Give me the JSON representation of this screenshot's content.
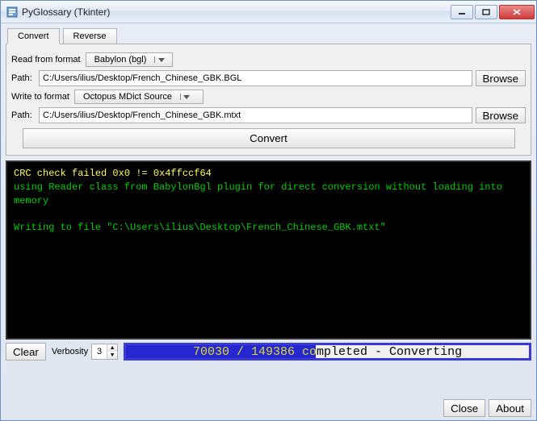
{
  "window": {
    "title": "PyGlossary (Tkinter)"
  },
  "tabs": {
    "convert": "Convert",
    "reverse": "Reverse"
  },
  "form": {
    "read_label": "Read from format",
    "read_format": "Babylon (bgl)",
    "path_label": "Path:",
    "read_path": "C:/Users/ilius/Desktop/French_Chinese_GBK.BGL",
    "browse": "Browse",
    "write_label": "Write to format",
    "write_format": "Octopus MDict Source",
    "write_path": "C:/Users/ilius/Desktop/French_Chinese_GBK.mtxt",
    "convert": "Convert"
  },
  "console": {
    "line1": "CRC check failed 0x0 != 0x4ffccf64",
    "line2": "using Reader class from BabylonBgl plugin for direct conversion without loading into memory",
    "line3": "Writing to file \"C:\\Users\\ilius\\Desktop\\French_Chinese_GBK.mtxt\""
  },
  "bottom": {
    "clear": "Clear",
    "verbosity_label": "Verbosity",
    "verbosity_value": "3",
    "progress_text": "70030 / 149386 completed - Converting"
  },
  "footer": {
    "close": "Close",
    "about": "About"
  }
}
